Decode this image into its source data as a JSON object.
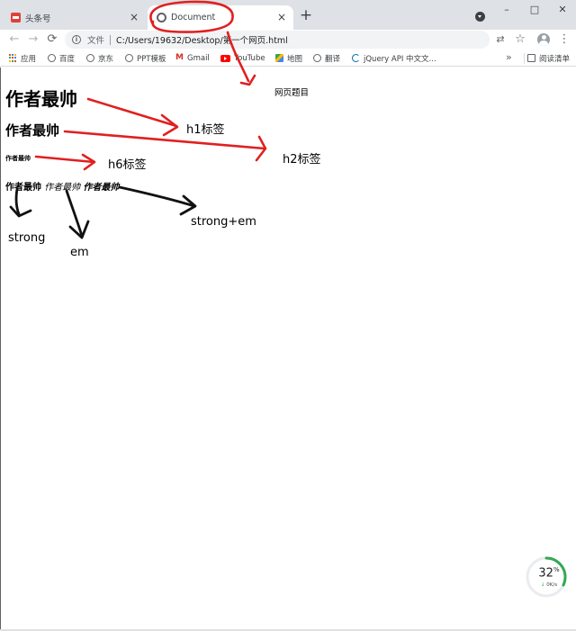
{
  "browser": {
    "tabs": [
      {
        "title": "头条号",
        "favicon": "toutiao-logo-icon"
      },
      {
        "title": "Document",
        "favicon": "globe-icon"
      }
    ],
    "close_icon": "×",
    "new_tab_icon": "+",
    "window_controls": {
      "minimize": "–",
      "maximize": "□",
      "close": "✕"
    },
    "nav": {
      "back": "←",
      "forward": "→",
      "reload": "⟳"
    },
    "address": {
      "info_icon": "i",
      "label": "文件",
      "url": "C:/Users/19632/Desktop/第一个网页.html"
    },
    "toolbar_icons": {
      "translate": "⇄",
      "bookmark_star": "☆",
      "menu": "⋮"
    }
  },
  "bookmarks": {
    "items": [
      {
        "label": "应用",
        "icon": "apps-grid-icon"
      },
      {
        "label": "百度",
        "icon": "globe-icon"
      },
      {
        "label": "京东",
        "icon": "globe-icon"
      },
      {
        "label": "PPT模板",
        "icon": "globe-icon"
      },
      {
        "label": "Gmail",
        "icon": "gmail-icon"
      },
      {
        "label": "YouTube",
        "icon": "youtube-icon"
      },
      {
        "label": "地图",
        "icon": "maps-icon"
      },
      {
        "label": "翻译",
        "icon": "globe-icon"
      },
      {
        "label": "jQuery API 中文文...",
        "icon": "jquery-icon"
      }
    ],
    "more": "»",
    "reading_list": "阅读清单"
  },
  "page": {
    "h1": "作者最帅",
    "h2": "作者最帅",
    "h6": "作者最帅",
    "strong": "作者最帅",
    "em": "作者最帅",
    "strong_em": "作者最帅"
  },
  "annotations": {
    "title_note": "网页题目",
    "h1_note": "h1标签",
    "h2_note": "h2标签",
    "h6_note": "h6标签",
    "strong_note": "strong",
    "em_note": "em",
    "strong_em_note": "strong+em"
  },
  "speed_widget": {
    "percent": "32",
    "unit": "%",
    "rate": "0K/s",
    "arrow": "↓",
    "level": 0.32
  },
  "colors": {
    "red_annotation": "#e02020",
    "green_progress": "#34a853",
    "tab_strip": "#dee1e6"
  }
}
